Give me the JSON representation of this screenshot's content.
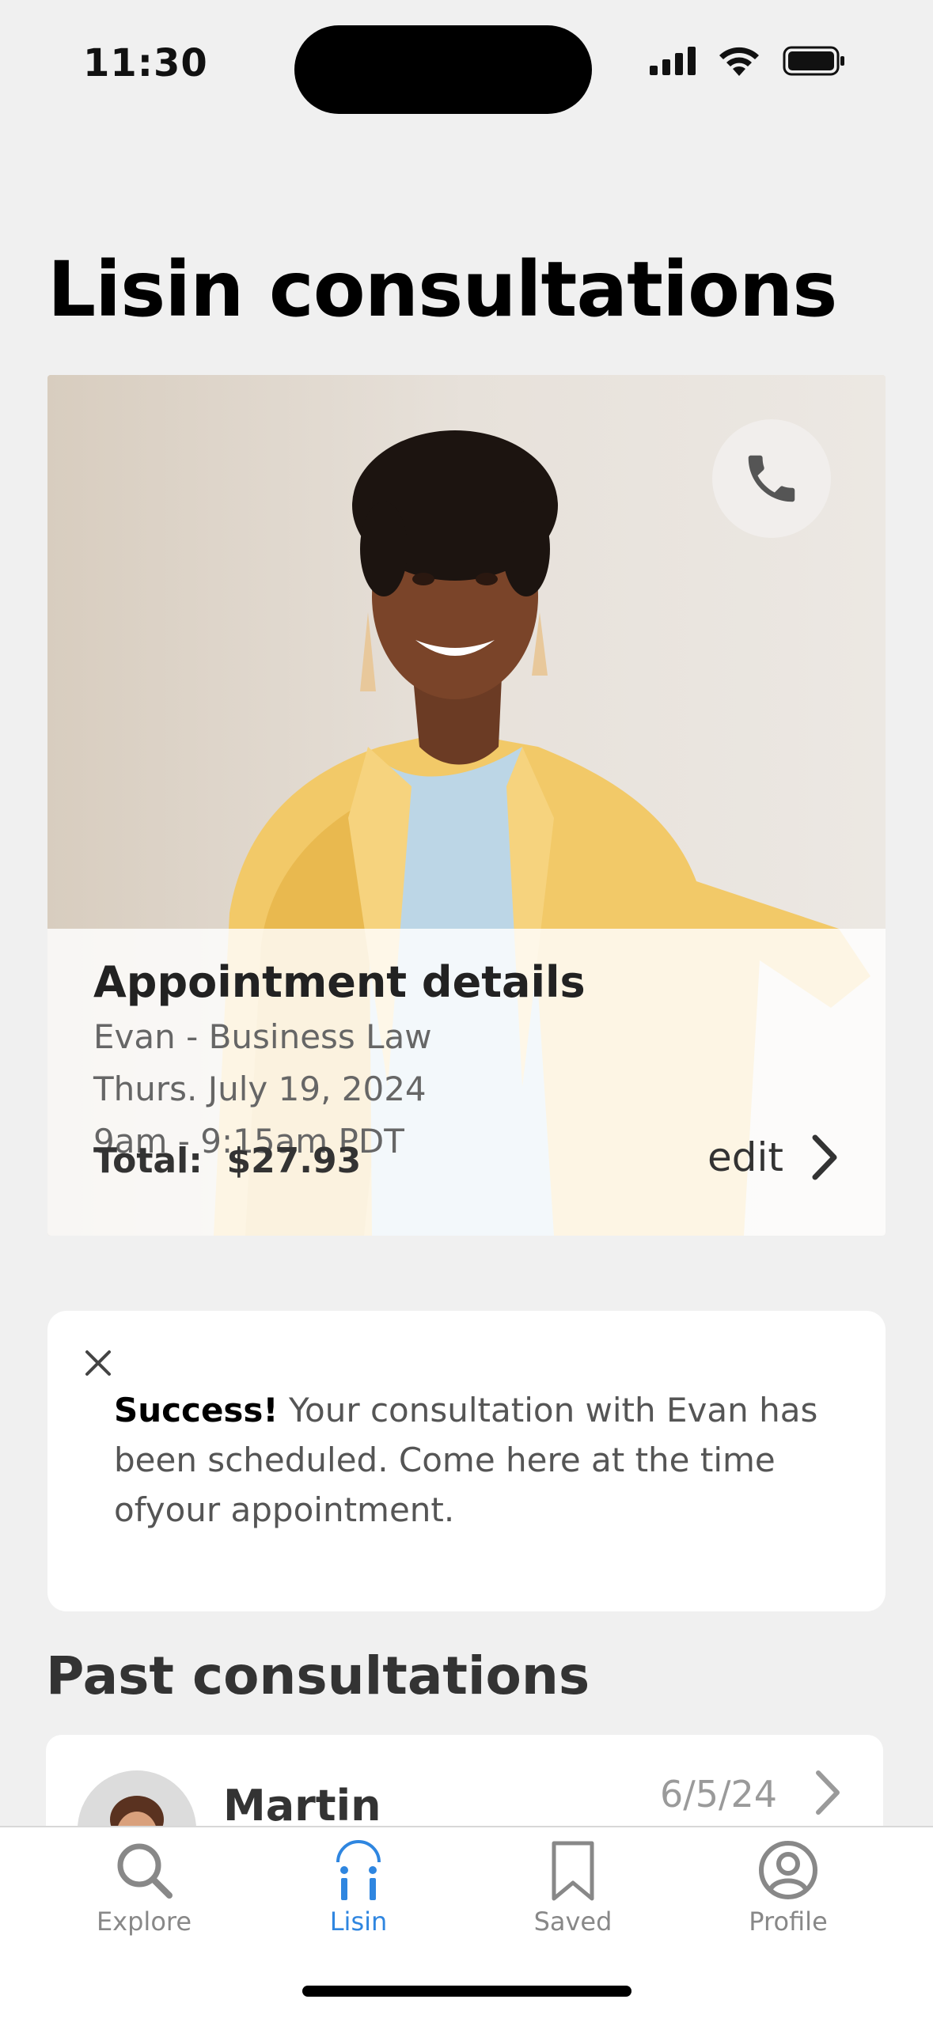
{
  "status_bar": {
    "time": "11:30"
  },
  "page_title": "Lisin consultations",
  "appointment": {
    "title": "Appointment details",
    "lawyer": "Evan - Business Law",
    "date": "Thurs. July 19, 2024",
    "time": "9am - 9:15am PDT",
    "total_label": "Total:",
    "total_value": "$27.93",
    "edit_label": "edit"
  },
  "toast": {
    "title": "Success!",
    "message": " Your consultation with Evan has been scheduled. Come here at the time ofyour appointment."
  },
  "past": {
    "heading": "Past consultations",
    "items": [
      {
        "name": "Martin",
        "date": "6/5/24"
      }
    ]
  },
  "tabs": [
    {
      "label": "Explore",
      "icon": "search-icon",
      "active": false
    },
    {
      "label": "Lisin",
      "icon": "lisin-icon",
      "active": true
    },
    {
      "label": "Saved",
      "icon": "bookmark-icon",
      "active": false
    },
    {
      "label": "Profile",
      "icon": "profile-icon",
      "active": false
    }
  ],
  "colors": {
    "accent": "#2f86e0",
    "background": "#f0f0f0",
    "card": "#ffffff"
  }
}
